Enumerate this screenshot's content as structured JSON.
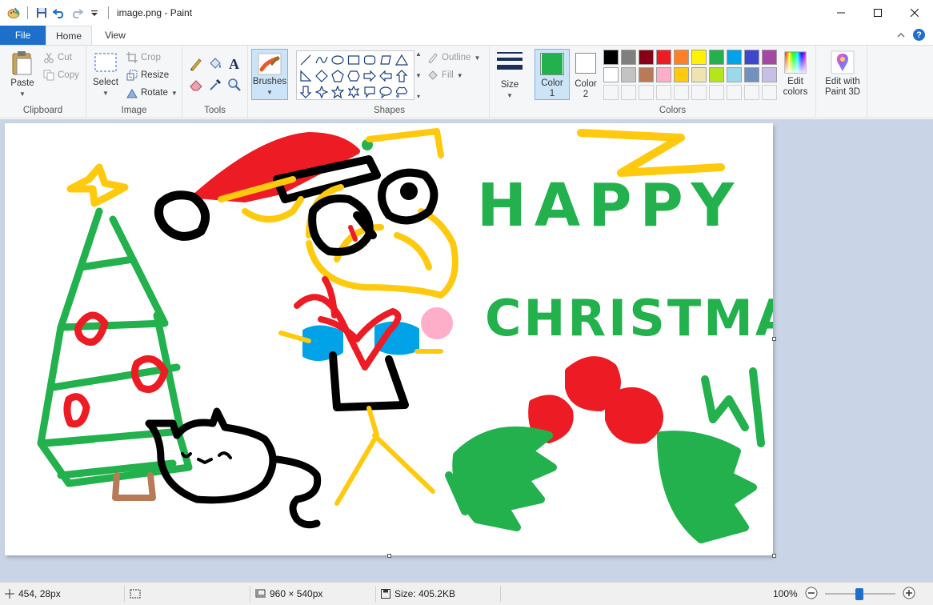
{
  "window": {
    "title": "image.png - Paint"
  },
  "tabs": {
    "file": "File",
    "home": "Home",
    "view": "View"
  },
  "clipboard": {
    "paste": "Paste",
    "cut": "Cut",
    "copy": "Copy",
    "label": "Clipboard"
  },
  "image": {
    "select": "Select",
    "crop": "Crop",
    "resize": "Resize",
    "rotate": "Rotate",
    "label": "Image"
  },
  "tools": {
    "label": "Tools"
  },
  "brushes": {
    "label": "Brushes"
  },
  "shapes": {
    "outline": "Outline",
    "fill": "Fill",
    "label": "Shapes"
  },
  "size": {
    "label": "Size"
  },
  "colors": {
    "color1_label": "Color 1",
    "color1_line1": "Color",
    "color1_line2": "1",
    "color2_line1": "Color",
    "color2_line2": "2",
    "color1_value": "#22b14c",
    "color2_value": "#ffffff",
    "edit_colors_line1": "Edit",
    "edit_colors_line2": "colors",
    "label": "Colors",
    "palette_row1": [
      "#000000",
      "#7f7f7f",
      "#880015",
      "#ed1c24",
      "#ff7f27",
      "#fff200",
      "#22b14c",
      "#00a2e8",
      "#3f48cc",
      "#a349a4"
    ],
    "palette_row2": [
      "#ffffff",
      "#c3c3c3",
      "#b97a57",
      "#ffaec9",
      "#ffc90e",
      "#efe4b0",
      "#b5e61d",
      "#99d9ea",
      "#7092be",
      "#c8bfe7"
    ]
  },
  "paint3d": {
    "line1": "Edit with",
    "line2": "Paint 3D"
  },
  "status": {
    "cursor_pos": "454, 28px",
    "dimensions": "960 × 540px",
    "file_size": "Size: 405.2KB",
    "zoom": "100%"
  },
  "drawing": {
    "text_line1": "HAPPY",
    "text_line2": "CHRISTMAS"
  }
}
